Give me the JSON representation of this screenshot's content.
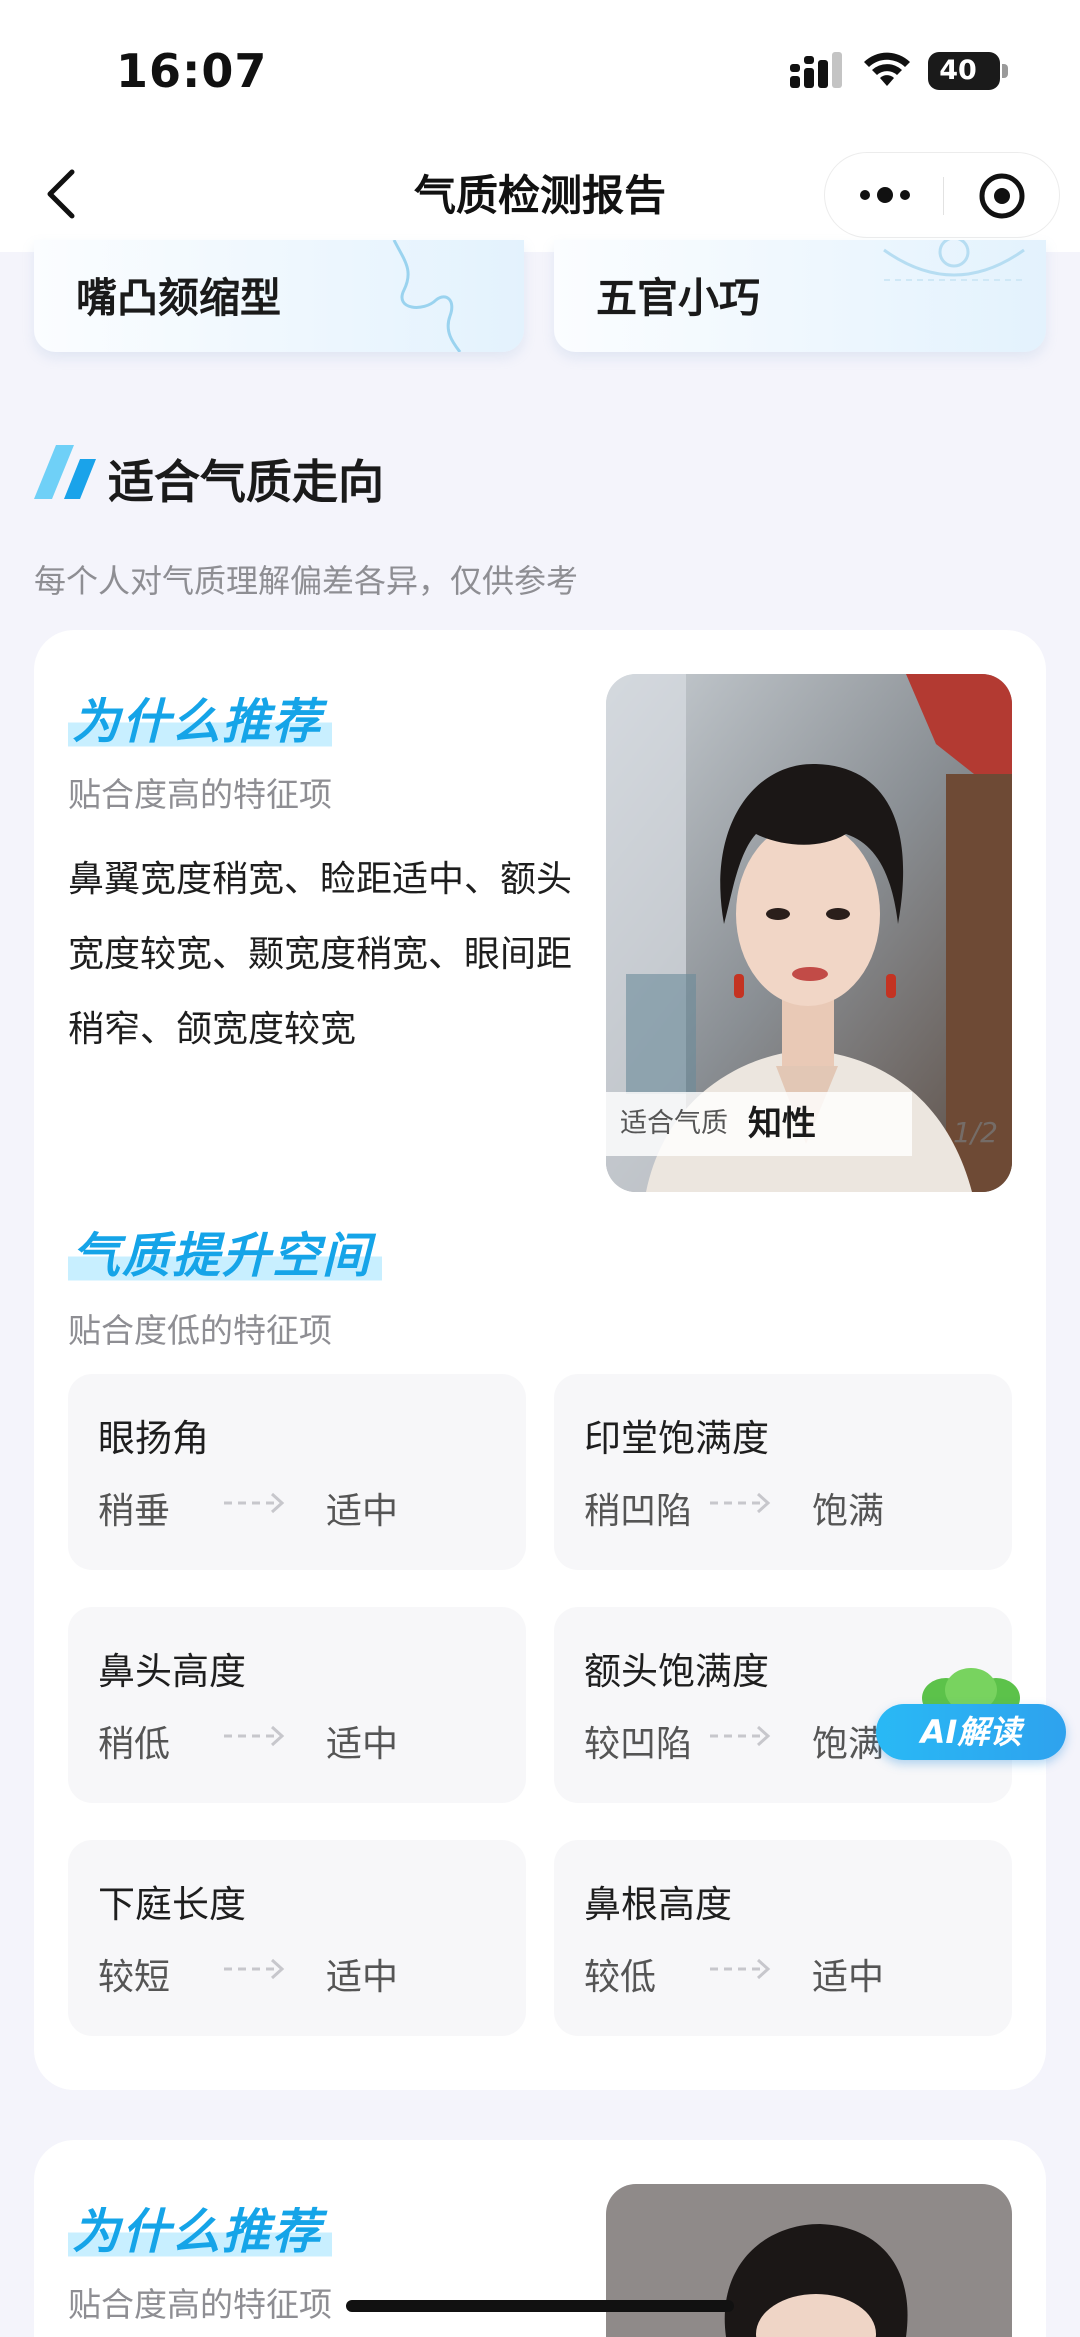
{
  "status_bar": {
    "time": "16:07",
    "battery": "40"
  },
  "nav": {
    "title": "气质检测报告"
  },
  "top_cards": [
    {
      "label": "嘴凸颏缩型"
    },
    {
      "label": "五官小巧"
    }
  ],
  "section": {
    "title": "适合气质走向",
    "subtitle": "每个人对气质理解偏差各异，仅供参考"
  },
  "recommend": {
    "why_title": "为什么推荐",
    "why_sub": "贴合度高的特征项",
    "reasons": "鼻翼宽度稍宽、睑距适中、额头宽度较宽、颞宽度稍宽、眼间距稍窄、颌宽度较宽",
    "photo_tag_label": "适合气质",
    "photo_tag_value": "知性",
    "photo_page": "1/2",
    "improve_title": "气质提升空间",
    "improve_sub": "贴合度低的特征项",
    "items": [
      {
        "name": "眼扬角",
        "from": "稍垂",
        "to": "适中"
      },
      {
        "name": "印堂饱满度",
        "from": "稍凹陷",
        "to": "饱满"
      },
      {
        "name": "鼻头高度",
        "from": "稍低",
        "to": "适中"
      },
      {
        "name": "额头饱满度",
        "from": "较凹陷",
        "to": "饱满"
      },
      {
        "name": "下庭长度",
        "from": "较短",
        "to": "适中"
      },
      {
        "name": "鼻根高度",
        "from": "较低",
        "to": "适中"
      }
    ]
  },
  "recommend2": {
    "why_title": "为什么推荐",
    "why_sub": "贴合度高的特征项"
  },
  "ai_button": {
    "label": "AI解读"
  }
}
